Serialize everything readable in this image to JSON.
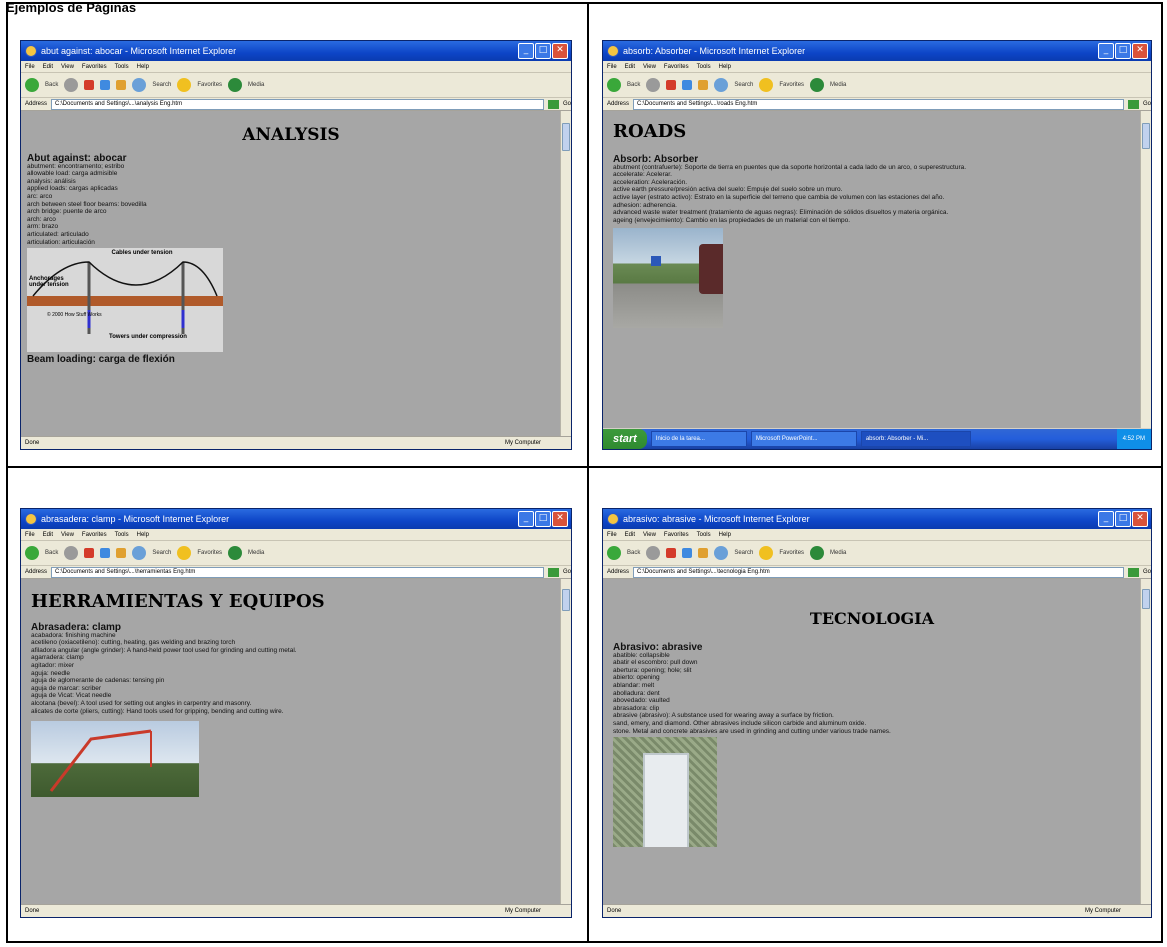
{
  "heading": "Ejemplos de Páginas",
  "windows": [
    {
      "title": "abut against: abocar - Microsoft Internet Explorer",
      "address": "C:\\Documents and Settings\\...\\analysis Eng.htm",
      "page_title": "ANALYSIS",
      "letter_heading": "Abut against: abocar",
      "lines": [
        "abutment: encontramento; estribo",
        "allowable load: carga admisible",
        "analysis: análisis",
        "applied loads: cargas aplicadas",
        "arc: arco",
        "arch between steel floor beams: bovedilla",
        "arch bridge: puente de arco",
        "arch: arco",
        "arm: brazo",
        "articulated: articulado",
        "articulation: articulación"
      ],
      "diagram": {
        "cables_label": "Cables under tension",
        "anchorages_label": "Anchorages under tension",
        "towers_label": "Towers under compression",
        "credit": "© 2000 How Stuff Works"
      },
      "next_heading": "Beam loading: carga de flexión",
      "status_left": "Done",
      "status_right": "My Computer"
    },
    {
      "title": "absorb: Absorber - Microsoft Internet Explorer",
      "address": "C:\\Documents and Settings\\...\\roads Eng.htm",
      "page_title": "ROADS",
      "letter_heading": "Absorb: Absorber",
      "lines": [
        "abutment (contrafuerte): Soporte de tierra en puentes que da soporte horizontal a cada lado de un arco, o superestructura.",
        "accelerate: Acelerar.",
        "acceleration: Aceleración.",
        "active earth pressure/presión activa del suelo: Empuje del suelo sobre un muro.",
        "active layer (estrato activo): Estrato en la superficie del terreno que cambia de volumen con las estaciones del año.",
        "adhesion: adherencia.",
        "advanced waste water treatment (tratamiento de aguas negras): Eliminación de sólidos disueltos y materia orgánica.",
        "ageing (envejecimiento): Cambio en las propiedades de un material con el tiempo."
      ],
      "taskbar": {
        "start": "start",
        "tasks": [
          "Inicio de la tarea...",
          "Microsoft PowerPoint...",
          "absorb: Absorber - Mi..."
        ],
        "tray": "4:52 PM"
      }
    },
    {
      "title": "abrasadera: clamp - Microsoft Internet Explorer",
      "address": "C:\\Documents and Settings\\...\\herramientas Eng.htm",
      "page_title": "HERRAMIENTAS Y EQUIPOS",
      "letter_heading": "Abrasadera: clamp",
      "lines": [
        "acabadora: finishing machine",
        "acetileno (oxiacetileno): cutting, heating, gas welding and brazing torch",
        "afiladora angular (angle grinder): A hand-held power tool used for grinding and cutting metal.",
        "agarradera: clamp",
        "agitador: mixer",
        "aguja: needle",
        "aguja de aglomerante de cadenas: tensing pin",
        "aguja de marcar: scriber",
        "aguja de Vicat: Vicat needle",
        "alcotana (bevel): A tool used for setting out angles in carpentry and masonry.",
        "alicates de corte (pliers, cutting): Hand tools used for gripping, bending and cutting wire."
      ],
      "status_left": "Done",
      "status_right": "My Computer"
    },
    {
      "title": "abrasivo: abrasive - Microsoft Internet Explorer",
      "address": "C:\\Documents and Settings\\...\\tecnologia Eng.htm",
      "page_title": "TECNOLOGIA",
      "letter_heading": "Abrasivo: abrasive",
      "lines": [
        "abatible: collapsible",
        "abatir el escombro: pull down",
        "abertura: opening; hole; slit",
        "abierto: opening",
        "ablandar: melt",
        "abolladura: dent",
        "abovedado: vaulted",
        "abrasadora: clip",
        "abrasive (abrasivo): A substance used for wearing away a surface by friction.",
        "sand, emery, and diamond. Other abrasives include silicon carbide and aluminum oxide.",
        "stone. Metal and concrete abrasives are used in grinding and cutting under various trade names."
      ],
      "status_left": "Done",
      "status_right": "My Computer"
    }
  ],
  "common": {
    "menu": [
      "File",
      "Edit",
      "View",
      "Favorites",
      "Tools",
      "Help"
    ],
    "toolbar": [
      "Back",
      "Search",
      "Favorites",
      "Media"
    ],
    "address_label": "Address",
    "go_label": "Go"
  }
}
